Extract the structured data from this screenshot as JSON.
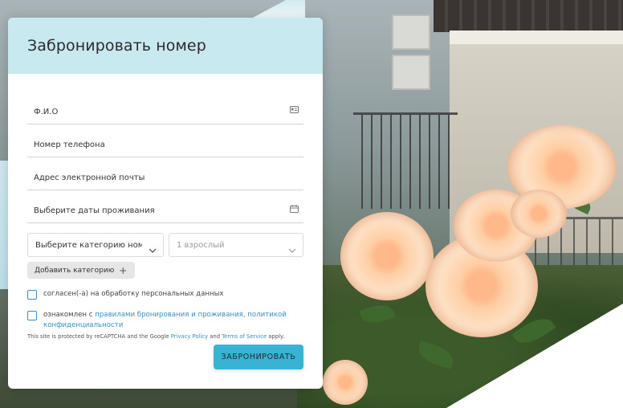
{
  "card": {
    "title": "Забронировать номер"
  },
  "fields": {
    "name": {
      "label": "Ф.И.О",
      "icon": "id-card-icon"
    },
    "phone": {
      "label": "Номер телефона"
    },
    "email": {
      "label": "Адрес электронной почты"
    },
    "dates": {
      "label": "Выберите даты проживания",
      "icon": "calendar-icon"
    }
  },
  "selects": {
    "category": {
      "value": "Выберите категорию номе...",
      "icon": "chevron-down-icon"
    },
    "guests": {
      "value": "1 взрослый",
      "icon": "chevron-down-icon"
    }
  },
  "add_category": {
    "label": "Добавить категорию",
    "icon": "plus-icon"
  },
  "consent": {
    "personal_data": "согласен(-а) на обработку персональных данных",
    "rules_prefix": "ознакомлен с ",
    "rules_link": "правилами бронирования и проживания, политикой конфиденциальности"
  },
  "recaptcha": {
    "text_1": "This site is protected by reCAPTCHA and the Google ",
    "privacy_link": "Privacy Policy",
    "text_2": " and ",
    "terms_link": "Terms of Service",
    "text_3": " apply."
  },
  "submit": {
    "label": "ЗАБРОНИРОВАТЬ"
  },
  "colors": {
    "header_bg": "#c9e9f0",
    "accent": "#38b3d3",
    "link": "#3a8fc0"
  }
}
